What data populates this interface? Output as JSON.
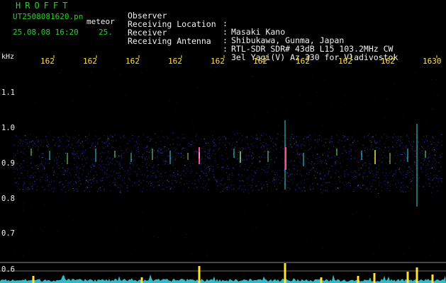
{
  "header": {
    "station_title": "HROFFT",
    "filename": "UT2508081620.pn",
    "mode": "meteor",
    "datetime": "25.08.08 16:20",
    "count": "25."
  },
  "metadata": [
    {
      "label": "Observer",
      "value": "Masaki Kano"
    },
    {
      "label": "Receiving Location",
      "value": "Shibukawa, Gunma, Japan"
    },
    {
      "label": "Receiver",
      "value": "RTL-SDR SDR# 43dB L15 103.2MHz CW"
    },
    {
      "label": "Receiving Antenna",
      "value": "3el Yagi(V) Az 330 for Vladivostok"
    }
  ],
  "y_axis": {
    "unit": "kHz",
    "ticks": [
      "1.1",
      "1.0",
      "0.9",
      "0.8",
      "0.7",
      "0.6"
    ]
  },
  "x_axis": {
    "ticks": [
      "162",
      "162",
      "162",
      "162",
      "162",
      "162",
      "162",
      "162",
      "162",
      "1630"
    ]
  },
  "colors": {
    "header_text": "#22d622",
    "info_text": "#f2f2f2",
    "time_ticks": "#ffe23a",
    "noise_band": "#2a2aa0",
    "meteor_trace": "#ff4aa0",
    "signal_level": "#3fd8e8",
    "level_peak": "#ffe23a"
  }
}
